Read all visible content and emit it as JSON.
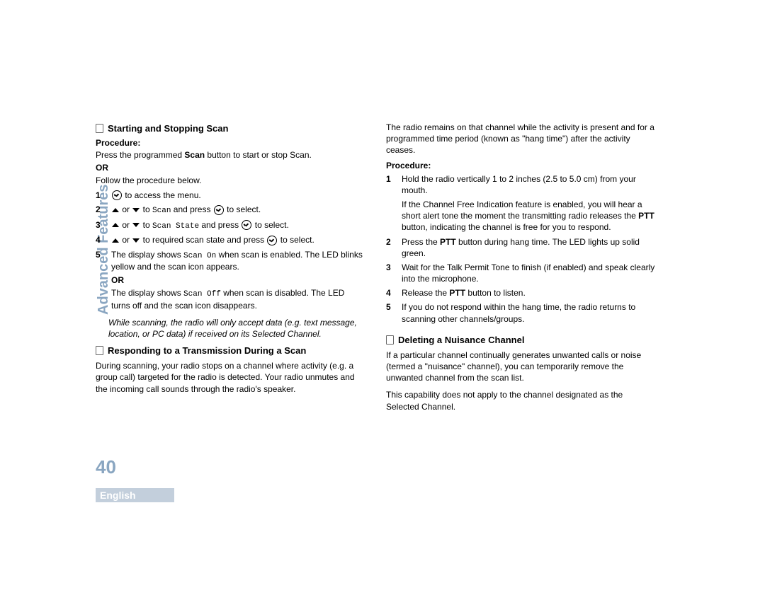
{
  "page": {
    "side_label": "Advanced Features",
    "number": "40",
    "lang": "English"
  },
  "left": {
    "h1": "Starting and Stopping Scan",
    "proc_label": "Procedure:",
    "press_line_a": "Press the programmed ",
    "scan_bold": "Scan",
    "press_line_b": " button to start or stop Scan.",
    "or": "OR",
    "follow": "Follow the procedure below.",
    "steps": [
      {
        "n": "1",
        "pre": "",
        "mid": "ok",
        "post": " to access the menu."
      },
      {
        "n": "2",
        "pre": "",
        "mid": "updown",
        "post_a": " or ",
        "post_b": " to ",
        "mono": "Scan",
        "post_c": " and press ",
        "ok": true,
        "post_d": " to select."
      },
      {
        "n": "3",
        "pre": "",
        "mid": "updown",
        "post_a": " or ",
        "post_b": " to ",
        "mono": "Scan State",
        "post_c": " and press ",
        "ok": true,
        "post_d": " to select."
      },
      {
        "n": "4",
        "pre": "",
        "mid": "updown",
        "post_a": " or ",
        "post_b": " to required scan state and press ",
        "ok": true,
        "post_d": " to select."
      },
      {
        "n": "5",
        "text_a": "The display shows ",
        "mono_a": "Scan On",
        "text_b": " when scan is enabled. The LED blinks yellow and the scan icon appears."
      }
    ],
    "step5_or": "OR",
    "step5_off_a": "The display shows ",
    "step5_off_mono": "Scan Off",
    "step5_off_b": " when scan is disabled. The LED turns off and the scan icon disappears.",
    "note": "While scanning, the radio will only accept data (e.g. text message, location, or PC data) if received on its Selected Channel.",
    "h2": "Responding to a Transmission During a Scan",
    "p2": "During scanning, your radio stops on a channel where activity (e.g. a group call) targeted for the radio is detected. Your radio unmutes and the incoming call sounds through the radio's speaker."
  },
  "right": {
    "p0": "The radio remains on that channel while the activity is present and for a programmed time period (known as \"hang time\") after the activity ceases.",
    "proc_label": "Procedure:",
    "steps": [
      {
        "n": "1",
        "a": "Hold the radio vertically 1 to 2 inches (2.5 to 5.0 cm) from your mouth.",
        "b_a": "If the Channel Free Indication feature is enabled, you will hear a short alert tone the moment the transmitting radio releases the ",
        "ptt": "PTT",
        "b_b": " button, indicating the channel is free for you to respond."
      },
      {
        "n": "2",
        "a": "Press the ",
        "ptt": "PTT",
        "b": " button during hang time. The LED lights up solid green."
      },
      {
        "n": "3",
        "a": "Wait for the Talk Permit Tone to finish (if enabled) and speak clearly into the microphone."
      },
      {
        "n": "4",
        "a": "Release the ",
        "ptt": "PTT",
        "b": " button to listen."
      },
      {
        "n": "5",
        "a": "If you do not respond within the hang time, the radio returns to scanning other channels/groups."
      }
    ],
    "h3": "Deleting a Nuisance Channel",
    "p3": "If a particular channel continually generates unwanted calls or noise (termed a \"nuisance\" channel), you can temporarily remove the unwanted channel from the scan list.",
    "p4": "This capability does not apply to the channel designated as the Selected Channel."
  }
}
